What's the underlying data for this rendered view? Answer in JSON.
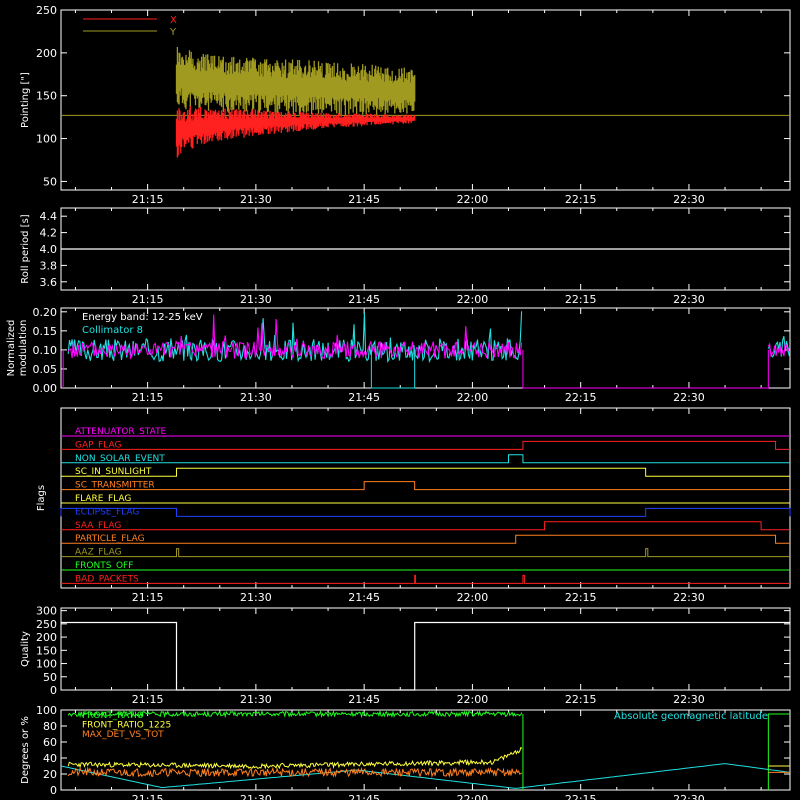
{
  "time_ticks": [
    "21:15",
    "21:30",
    "21:45",
    "22:00",
    "22:15",
    "22:30"
  ],
  "time_range_min": [
    1263,
    1364
  ],
  "panels": {
    "pointing": {
      "ylabel": "Pointing [\"]",
      "ylim": [
        40,
        250
      ],
      "yticks": [
        "50",
        "100",
        "150",
        "200",
        "250"
      ],
      "ref_line": 127,
      "legend": [
        {
          "name": "X",
          "color": "#ff2020"
        },
        {
          "name": "Y",
          "color": "#a09a20"
        }
      ]
    },
    "roll": {
      "ylabel": "Roll period [s]",
      "ylim": [
        3.5,
        4.5
      ],
      "yticks": [
        "3.6",
        "3.8",
        "4.0",
        "4.2",
        "4.4"
      ],
      "value": 4.0
    },
    "modulation": {
      "ylabel_1": "Normalized",
      "ylabel_2": "modulation",
      "ylim": [
        0,
        0.21
      ],
      "yticks": [
        "0.00",
        "0.05",
        "0.10",
        "0.15",
        "0.20"
      ],
      "energy_band": "Energy band: 12-25 keV",
      "collimator": "Collimator 8"
    },
    "flags": {
      "ylabel": "Flags",
      "items": [
        {
          "name": "ATTENUATOR_STATE",
          "color": "#ff00ff"
        },
        {
          "name": "GAP_FLAG",
          "color": "#ff2020"
        },
        {
          "name": "NON_SOLAR_EVENT",
          "color": "#20e0e0"
        },
        {
          "name": "SC_IN_SUNLIGHT",
          "color": "#ffff40"
        },
        {
          "name": "SC_TRANSMITTER",
          "color": "#ff8020"
        },
        {
          "name": "FLARE_FLAG",
          "color": "#ffff40"
        },
        {
          "name": "ECLIPSE_FLAG",
          "color": "#2040ff"
        },
        {
          "name": "SAA_FLAG",
          "color": "#ff2020"
        },
        {
          "name": "PARTICLE_FLAG",
          "color": "#ff8020"
        },
        {
          "name": "AAZ_FLAG",
          "color": "#a09a20"
        },
        {
          "name": "FRONTS_OFF",
          "color": "#20ff20"
        },
        {
          "name": "BAD_PACKETS",
          "color": "#ff2020"
        }
      ]
    },
    "quality": {
      "ylabel": "Quality",
      "ylim": [
        0,
        310
      ],
      "yticks": [
        "0",
        "50",
        "100",
        "150",
        "200",
        "250",
        "300"
      ]
    },
    "degrees": {
      "ylabel": "Degrees or %",
      "ylim": [
        0,
        100
      ],
      "yticks": [
        "0",
        "20",
        "40",
        "60",
        "80",
        "100"
      ],
      "legend": [
        {
          "name": "FRONT_RATIO",
          "color": "#20ff20"
        },
        {
          "name": "FRONT_RATIO_1225",
          "color": "#ffff40"
        },
        {
          "name": "MAX_DET_VS_TOT",
          "color": "#ff8020"
        }
      ],
      "geo_label": "Absolute geomagnetic latitude",
      "geo_color": "#20e0e0"
    }
  },
  "chart_data": [
    {
      "type": "line",
      "title": "",
      "ylabel": "Pointing [\"]",
      "ylim": [
        40,
        250
      ],
      "x_unit": "time",
      "series": [
        {
          "name": "X",
          "x": [
            "21:19",
            "21:22",
            "21:30",
            "21:40",
            "21:52"
          ],
          "y_min": [
            75,
            92,
            103,
            112,
            118
          ],
          "y_max": [
            140,
            137,
            134,
            130,
            128
          ]
        },
        {
          "name": "Y",
          "x": [
            "21:19",
            "21:22",
            "21:30",
            "21:40",
            "21:52"
          ],
          "y_min": [
            135,
            131,
            129,
            127,
            126
          ],
          "y_max": [
            210,
            200,
            195,
            190,
            183
          ]
        }
      ]
    },
    {
      "type": "line",
      "ylabel": "Roll period [s]",
      "ylim": [
        3.5,
        4.5
      ],
      "series": [
        {
          "x": [
            "21:03",
            "22:44"
          ],
          "y": [
            4.0,
            4.0
          ]
        }
      ]
    },
    {
      "type": "line",
      "ylabel": "Normalized modulation",
      "ylim": [
        0,
        0.21
      ],
      "series": [
        {
          "name": "Energy band: 12-25 keV",
          "x": [
            "21:04",
            "22:07",
            "22:07",
            "22:41"
          ],
          "y": [
            0.1,
            0.1,
            0.0,
            0.0
          ]
        },
        {
          "name": "Collimator 8",
          "x": [
            "21:46",
            "21:46",
            "21:52",
            "21:52"
          ],
          "y": [
            0.1,
            0.0,
            0.0,
            0.1
          ]
        }
      ]
    },
    {
      "type": "line",
      "ylabel": "Quality",
      "ylim": [
        0,
        310
      ],
      "series": [
        {
          "x": [
            "21:03",
            "21:19",
            "21:19",
            "21:52",
            "21:52",
            "22:44"
          ],
          "y": [
            255,
            255,
            0,
            0,
            255,
            255
          ]
        }
      ]
    },
    {
      "type": "line",
      "ylabel": "Degrees or %",
      "ylim": [
        0,
        100
      ],
      "series": [
        {
          "name": "FRONT_RATIO",
          "x": [
            "21:04",
            "22:07"
          ],
          "y": [
            95,
            95
          ]
        },
        {
          "name": "FRONT_RATIO_1225",
          "x": [
            "21:04",
            "21:30",
            "22:03",
            "22:07"
          ],
          "y": [
            32,
            30,
            35,
            52
          ]
        },
        {
          "name": "MAX_DET_VS_TOT",
          "x": [
            "21:04",
            "22:07"
          ],
          "y": [
            22,
            22
          ]
        },
        {
          "name": "Absolute geomagnetic latitude",
          "x": [
            "21:03",
            "21:17",
            "21:44",
            "22:06",
            "22:35",
            "22:44"
          ],
          "y": [
            30,
            3,
            25,
            2,
            33,
            22
          ]
        }
      ]
    }
  ]
}
